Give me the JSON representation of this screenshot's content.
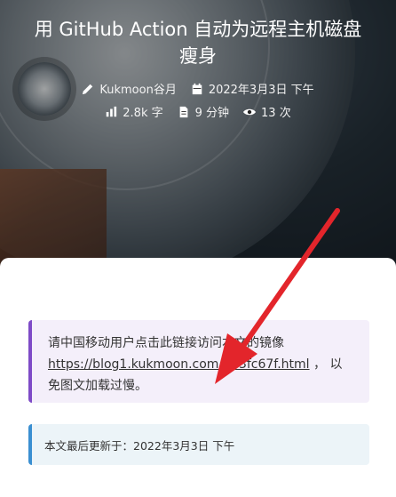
{
  "post": {
    "title": "用 GitHub Action 自动为远程主机磁盘瘦身",
    "author": "Kukmoon谷月",
    "date": "2022年3月3日 下午",
    "word_count": "2.8k 字",
    "read_time": "9 分钟",
    "views": "13 次"
  },
  "notice": {
    "text_before": "请中国移动用户点击此链接访问本文的镜像",
    "link": "https://blog1.kukmoon.com/843fc67f.html",
    "text_after": "， 以免图文加载过慢。"
  },
  "updated": {
    "label": "本文最后更新于：",
    "value": "2022年3月3日 下午"
  },
  "icons": [
    "pencil-icon",
    "calendar-icon",
    "chart-icon",
    "document-icon",
    "eye-icon"
  ],
  "colors": {
    "notice_accent": "#7e4bc7",
    "updated_accent": "#3a8fd1",
    "arrow": "#e3252b"
  }
}
